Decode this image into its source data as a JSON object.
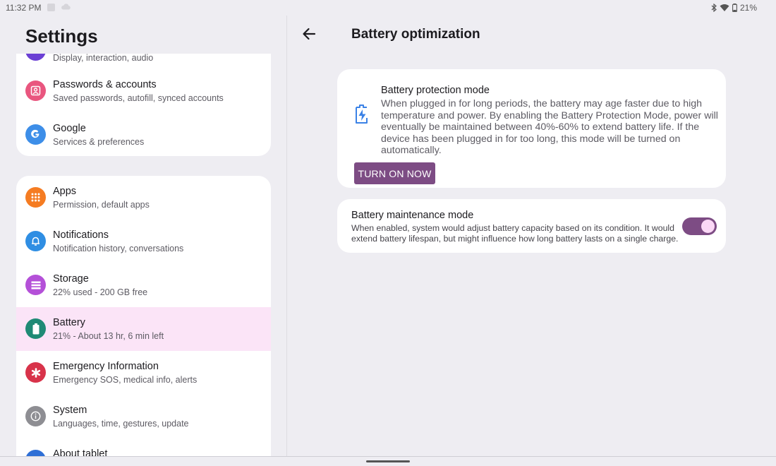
{
  "status_bar": {
    "time": "11:32 PM",
    "battery_percent": "21%",
    "icons": [
      "notification-square-icon",
      "cloud-icon",
      "bluetooth-icon",
      "wifi-icon",
      "battery-icon"
    ]
  },
  "left_pane": {
    "title": "Settings",
    "group_1": [
      {
        "title": "",
        "subtitle": "Display, interaction, audio",
        "icon": "display-icon",
        "color": "#6b3fd4"
      },
      {
        "title": "Passwords & accounts",
        "subtitle": "Saved passwords, autofill, synced accounts",
        "icon": "account-box-icon",
        "color": "#e9567f"
      },
      {
        "title": "Google",
        "subtitle": "Services & preferences",
        "icon": "google-icon",
        "color": "#3d8ee8"
      }
    ],
    "group_2": [
      {
        "title": "Apps",
        "subtitle": "Permission, default apps",
        "icon": "apps-grid-icon",
        "color": "#f57c22"
      },
      {
        "title": "Notifications",
        "subtitle": "Notification history, conversations",
        "icon": "bell-icon",
        "color": "#2f8ee3"
      },
      {
        "title": "Storage",
        "subtitle": "22% used - 200 GB free",
        "icon": "storage-icon",
        "color": "#b450d8"
      },
      {
        "title": "Battery",
        "subtitle": "21% - About 13 hr, 6 min left",
        "icon": "battery-icon",
        "color": "#1f8a75",
        "selected": true
      },
      {
        "title": "Emergency Information",
        "subtitle": "Emergency SOS, medical info, alerts",
        "icon": "asterisk-icon",
        "color": "#d8334a"
      },
      {
        "title": "System",
        "subtitle": "Languages, time, gestures, update",
        "icon": "info-icon",
        "color": "#8e8e93"
      },
      {
        "title": "About tablet",
        "subtitle": "",
        "icon": "tablet-icon",
        "color": "#2f6fd6"
      }
    ]
  },
  "right_pane": {
    "title": "Battery optimization",
    "protection": {
      "title": "Battery protection mode",
      "description": "When plugged in for long periods, the battery may age faster due to high temperature and power. By enabling the Battery Protection Mode, power will eventually be maintained between 40%-60% to extend battery life. If the device has been plugged in for too long, this mode will be turned on automatically.",
      "button_label": "TURN ON NOW"
    },
    "maintenance": {
      "title": "Battery maintenance mode",
      "description": "When enabled, system would adjust battery capacity based on its condition. It would extend battery lifespan, but might influence how long battery lasts on a single charge.",
      "toggle_on": true
    }
  },
  "colors": {
    "accent": "#7d4c84",
    "selected_bg": "#fbe4f7",
    "page_bg": "#eeedf2"
  }
}
